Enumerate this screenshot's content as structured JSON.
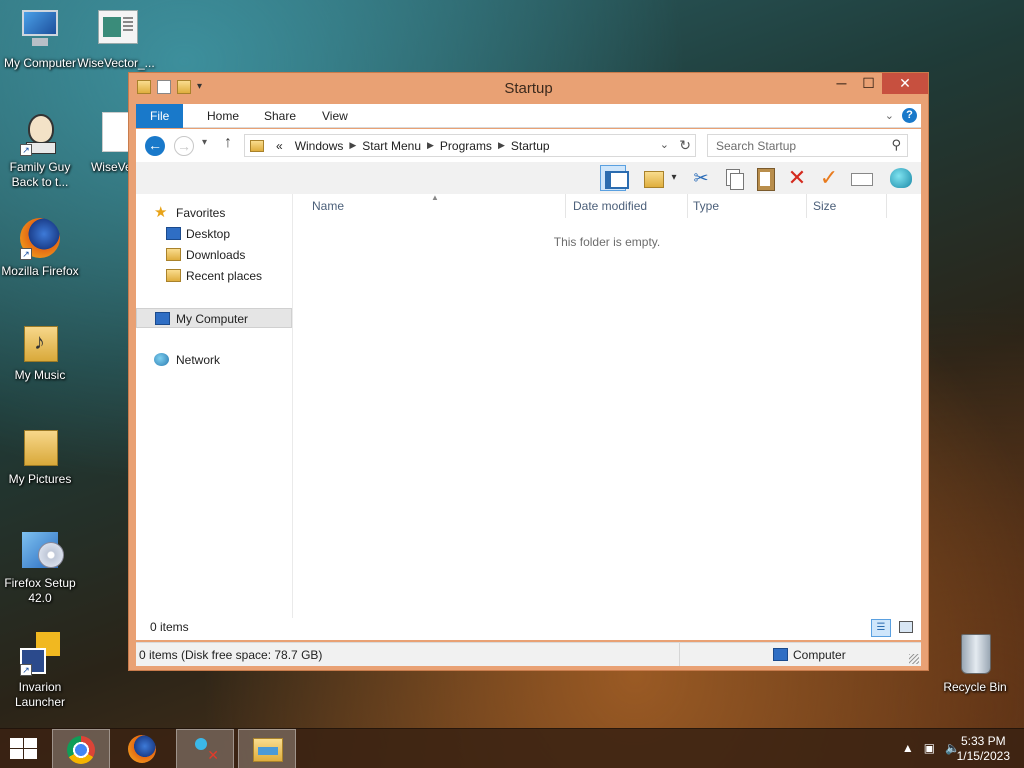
{
  "desktop": {
    "icons": [
      {
        "label": "My Computer"
      },
      {
        "label": "WiseVector_..."
      },
      {
        "label": "Family Guy Back to t..."
      },
      {
        "label": "WiseVect"
      },
      {
        "label": "Mozilla Firefox"
      },
      {
        "label": "My Music"
      },
      {
        "label": "My Pictures"
      },
      {
        "label": "Firefox Setup 42.0"
      },
      {
        "label": "Invarion Launcher"
      },
      {
        "label": "Recycle Bin"
      }
    ]
  },
  "window": {
    "title": "Startup",
    "controls": {
      "minimize": "─",
      "maximize": "☐",
      "close": "✕"
    },
    "ribbon_tabs": [
      "File",
      "Home",
      "Share",
      "View"
    ],
    "address": {
      "overflow": "«",
      "crumbs": [
        "Windows",
        "Start Menu",
        "Programs",
        "Startup"
      ]
    },
    "search": {
      "placeholder": "Search Startup"
    },
    "nav_pane": {
      "favorites": "Favorites",
      "favorite_items": [
        "Desktop",
        "Downloads",
        "Recent places"
      ],
      "computer": "My Computer",
      "network": "Network"
    },
    "columns": [
      "Name",
      "Date modified",
      "Type",
      "Size"
    ],
    "empty_message": "This folder is empty.",
    "items_count": "0 items",
    "status_left": "0 items (Disk free space: 78.7 GB)",
    "status_right": "Computer"
  },
  "taskbar": {
    "time": "5:33 PM",
    "date": "1/15/2023"
  },
  "colors": {
    "window_frame": "#e9a174",
    "accent": "#1979ca",
    "close_button": "#c7503f"
  }
}
